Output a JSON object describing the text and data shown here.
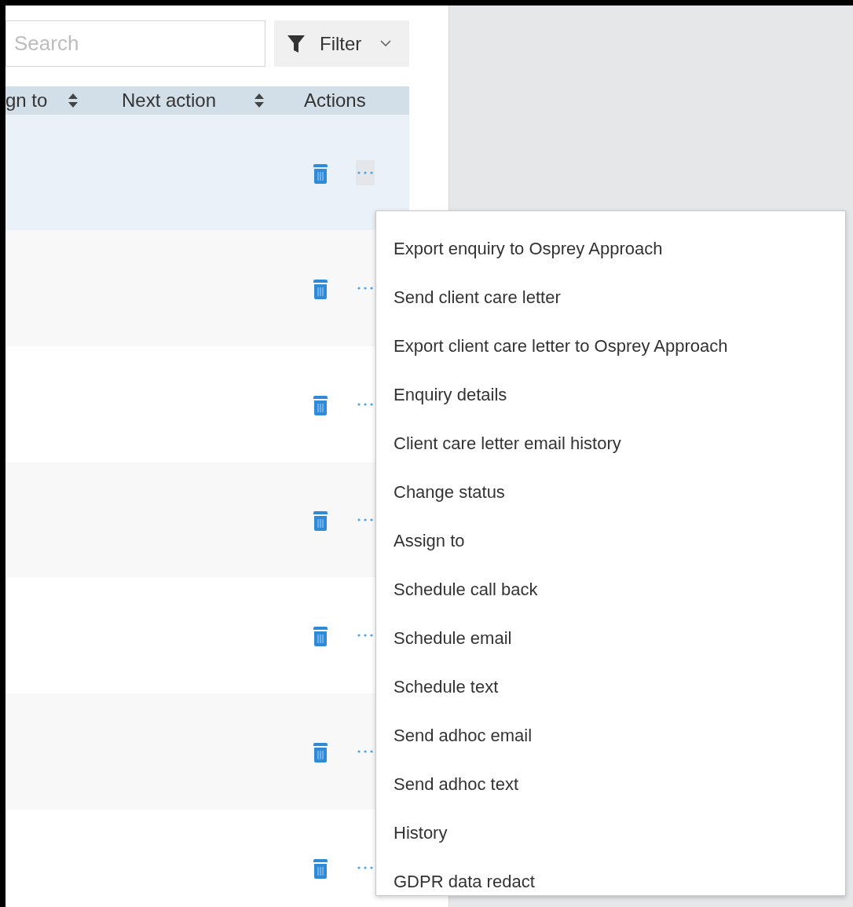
{
  "toolbar": {
    "search": {
      "placeholder": "Search"
    },
    "filter_button": {
      "label": "Filter"
    }
  },
  "table": {
    "columns": [
      {
        "label": "gn to",
        "sortable": true
      },
      {
        "label": "Next action",
        "sortable": true
      },
      {
        "label": "Actions",
        "sortable": false
      }
    ],
    "rows": [
      {
        "selected": true,
        "menu_open": true
      },
      {
        "selected": false,
        "menu_open": false
      },
      {
        "selected": false,
        "menu_open": false
      },
      {
        "selected": false,
        "menu_open": false
      },
      {
        "selected": false,
        "menu_open": false
      },
      {
        "selected": false,
        "menu_open": false
      },
      {
        "selected": false,
        "menu_open": false
      }
    ]
  },
  "context_menu": {
    "items": [
      "Export enquiry to Osprey Approach",
      "Send client care letter",
      "Export client care letter to Osprey Approach",
      "Enquiry details",
      "Client care letter email history",
      "Change status",
      "Assign to",
      "Schedule call back",
      "Schedule email",
      "Schedule text",
      "Send adhoc email",
      "Send adhoc text",
      "History",
      "GDPR data redact"
    ]
  }
}
